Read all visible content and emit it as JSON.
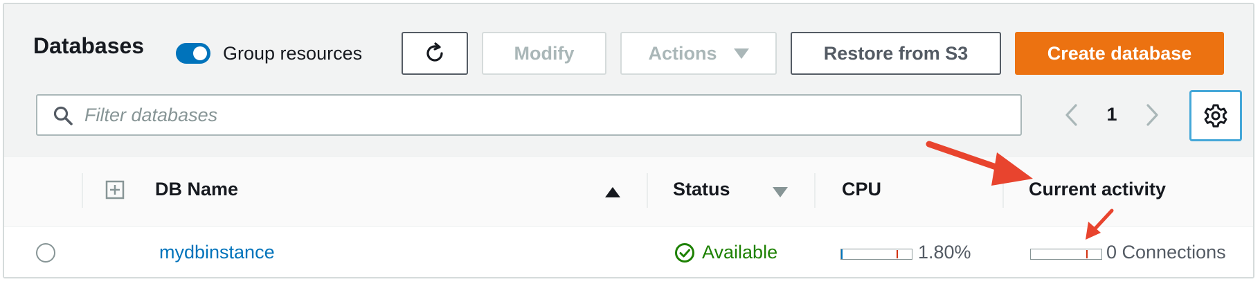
{
  "header": {
    "title": "Databases",
    "group_toggle": {
      "label": "Group resources",
      "checked": true
    },
    "buttons": {
      "refresh_icon": "refresh-icon",
      "modify": "Modify",
      "actions": "Actions",
      "restore": "Restore from S3",
      "create": "Create database"
    },
    "search": {
      "placeholder": "Filter databases",
      "value": ""
    },
    "pagination": {
      "current_page": "1"
    },
    "settings_icon": "gear-icon"
  },
  "table": {
    "columns": {
      "db_name": "DB Name",
      "status": "Status",
      "cpu": "CPU",
      "activity": "Current activity"
    },
    "rows": [
      {
        "db_name": "mydbinstance",
        "status": "Available",
        "cpu": "1.80%",
        "cpu_level": 0.018,
        "activity": "0 Connections"
      }
    ]
  },
  "colors": {
    "accent": "#0073bb",
    "primary_button": "#ec7211",
    "status_available": "#1d8102",
    "annotation_arrow": "#e8442e"
  }
}
